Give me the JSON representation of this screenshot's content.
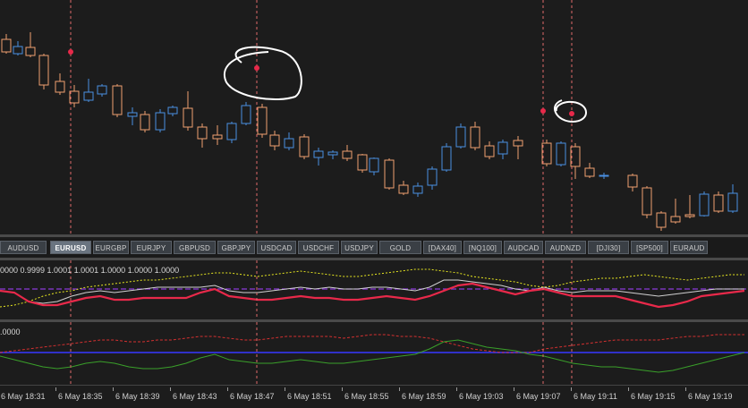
{
  "colors": {
    "background": "#1c1c1c",
    "bull": "#4a90e2",
    "bear": "#f0a070",
    "wick_bull": "#4a90e2",
    "wick_bear": "#f0a070",
    "marker": "#e8294a",
    "vline": "#e06a6a",
    "ind1_main": "#e8294a",
    "ind1_signal": "#d0d0d0",
    "ind1_upper": "#e6e620",
    "ind1_level": "#8a3ad8",
    "ind2_green": "#3aa02a",
    "ind2_red": "#d43030",
    "ind2_blue": "#3030c8"
  },
  "symbols": [
    "AUDUSD",
    "EURUSD",
    "EURGBP",
    "EURJPY",
    "GBPUSD",
    "GBPJPY",
    "USDCAD",
    "USDCHF",
    "USDJPY",
    "GOLD",
    "[DAX40]",
    "[NQ100]",
    "AUDCAD",
    "AUDNZD",
    "[DJI30]",
    "[SP500]",
    "EURAUD"
  ],
  "active_symbol": "EURUSD",
  "indicator1": {
    "label": "0000  0.9999  1.0001  1.0001  1.0000  1.0000  1.0000"
  },
  "indicator2": {
    "label": ".0000"
  },
  "time_axis": [
    "6 May 18:31",
    "6 May 18:35",
    "6 May 18:39",
    "6 May 18:43",
    "6 May 18:47",
    "6 May 18:51",
    "6 May 18:55",
    "6 May 18:59",
    "6 May 19:03",
    "6 May 19:07",
    "6 May 19:11",
    "6 May 19:15",
    "6 May 19:19"
  ],
  "annotations": [
    {
      "shape": "hand-drawn circle"
    },
    {
      "shape": "hand-drawn circle"
    }
  ]
}
